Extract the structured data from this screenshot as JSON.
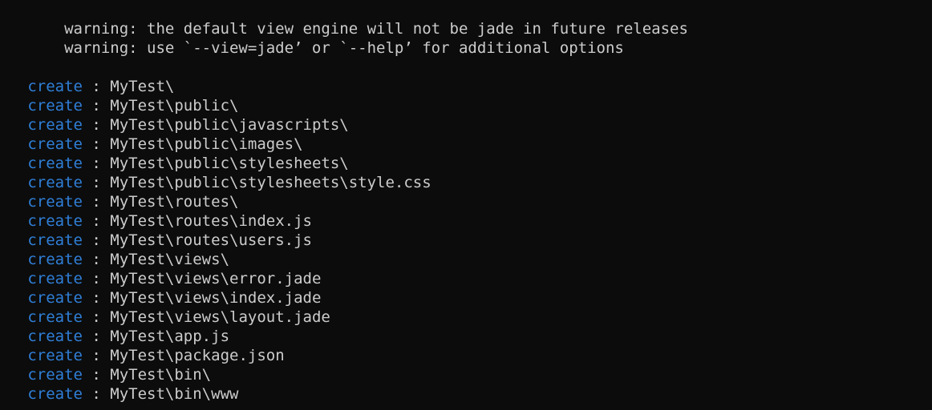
{
  "terminal": {
    "background_color": "#0c0c0c",
    "foreground_color": "#cccccc",
    "accent_color": "#2f7fd8",
    "font_size_px": 19,
    "line_height_px": 24,
    "columns": 96,
    "rows": 21
  },
  "warnings": [
    " warning: the default view engine will not be jade in future releases",
    " warning: use `--view=jade’ or `--help’ for additional options"
  ],
  "blank_lines": [
    "",
    ""
  ],
  "create_block": {
    "keyword": "create",
    "separator": ":",
    "entries": [
      {
        "indent": "   ",
        "keyword": "create",
        "separator": " : ",
        "path": "MyTest\\"
      },
      {
        "indent": "   ",
        "keyword": "create",
        "separator": " : ",
        "path": "MyTest\\public\\"
      },
      {
        "indent": "   ",
        "keyword": "create",
        "separator": " : ",
        "path": "MyTest\\public\\javascripts\\"
      },
      {
        "indent": "   ",
        "keyword": "create",
        "separator": " : ",
        "path": "MyTest\\public\\images\\"
      },
      {
        "indent": "   ",
        "keyword": "create",
        "separator": " : ",
        "path": "MyTest\\public\\stylesheets\\"
      },
      {
        "indent": "   ",
        "keyword": "create",
        "separator": " : ",
        "path": "MyTest\\public\\stylesheets\\style.css"
      },
      {
        "indent": "   ",
        "keyword": "create",
        "separator": " : ",
        "path": "MyTest\\routes\\"
      },
      {
        "indent": "   ",
        "keyword": "create",
        "separator": " : ",
        "path": "MyTest\\routes\\index.js"
      },
      {
        "indent": "   ",
        "keyword": "create",
        "separator": " : ",
        "path": "MyTest\\routes\\users.js"
      },
      {
        "indent": "   ",
        "keyword": "create",
        "separator": " : ",
        "path": "MyTest\\views\\"
      },
      {
        "indent": "   ",
        "keyword": "create",
        "separator": " : ",
        "path": "MyTest\\views\\error.jade"
      },
      {
        "indent": "   ",
        "keyword": "create",
        "separator": " : ",
        "path": "MyTest\\views\\index.jade"
      },
      {
        "indent": "   ",
        "keyword": "create",
        "separator": " : ",
        "path": "MyTest\\views\\layout.jade"
      },
      {
        "indent": "   ",
        "keyword": "create",
        "separator": " : ",
        "path": "MyTest\\app.js"
      },
      {
        "indent": "   ",
        "keyword": "create",
        "separator": " : ",
        "path": "MyTest\\package.json"
      },
      {
        "indent": "   ",
        "keyword": "create",
        "separator": " : ",
        "path": "MyTest\\bin\\"
      },
      {
        "indent": "   ",
        "keyword": "create",
        "separator": " : ",
        "path": "MyTest\\bin\\www"
      }
    ]
  }
}
